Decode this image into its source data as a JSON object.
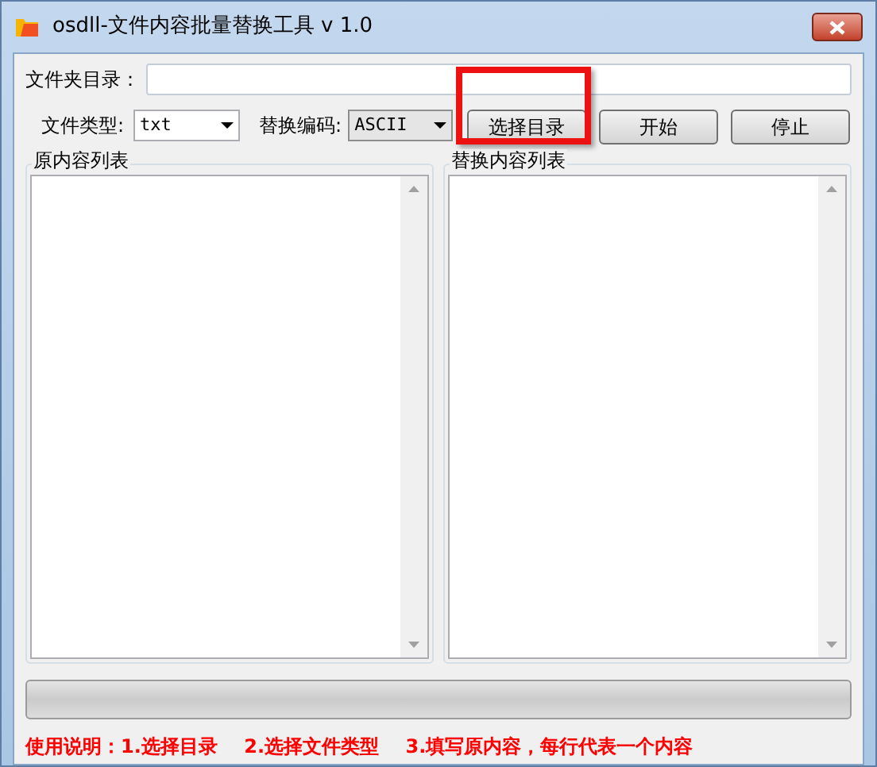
{
  "window": {
    "title": "osdll-文件内容批量替换工具 v 1.0"
  },
  "folder": {
    "label": "文件夹目录："
  },
  "file_type": {
    "label": "文件类型:",
    "value": "txt"
  },
  "encoding": {
    "label": "替换编码:",
    "value": "ASCII"
  },
  "buttons": [
    {
      "label": "选择目录",
      "highlighted": true
    },
    {
      "label": "开始",
      "highlighted": false
    },
    {
      "label": "停止",
      "highlighted": false
    }
  ],
  "groups": [
    {
      "title": "原内容列表"
    },
    {
      "title": "替换内容列表"
    }
  ],
  "progress": {
    "level": 0
  },
  "instructions": "使用说明：1.选择目录    2.选择文件类型    3.填写原内容，每行代表一个内容"
}
